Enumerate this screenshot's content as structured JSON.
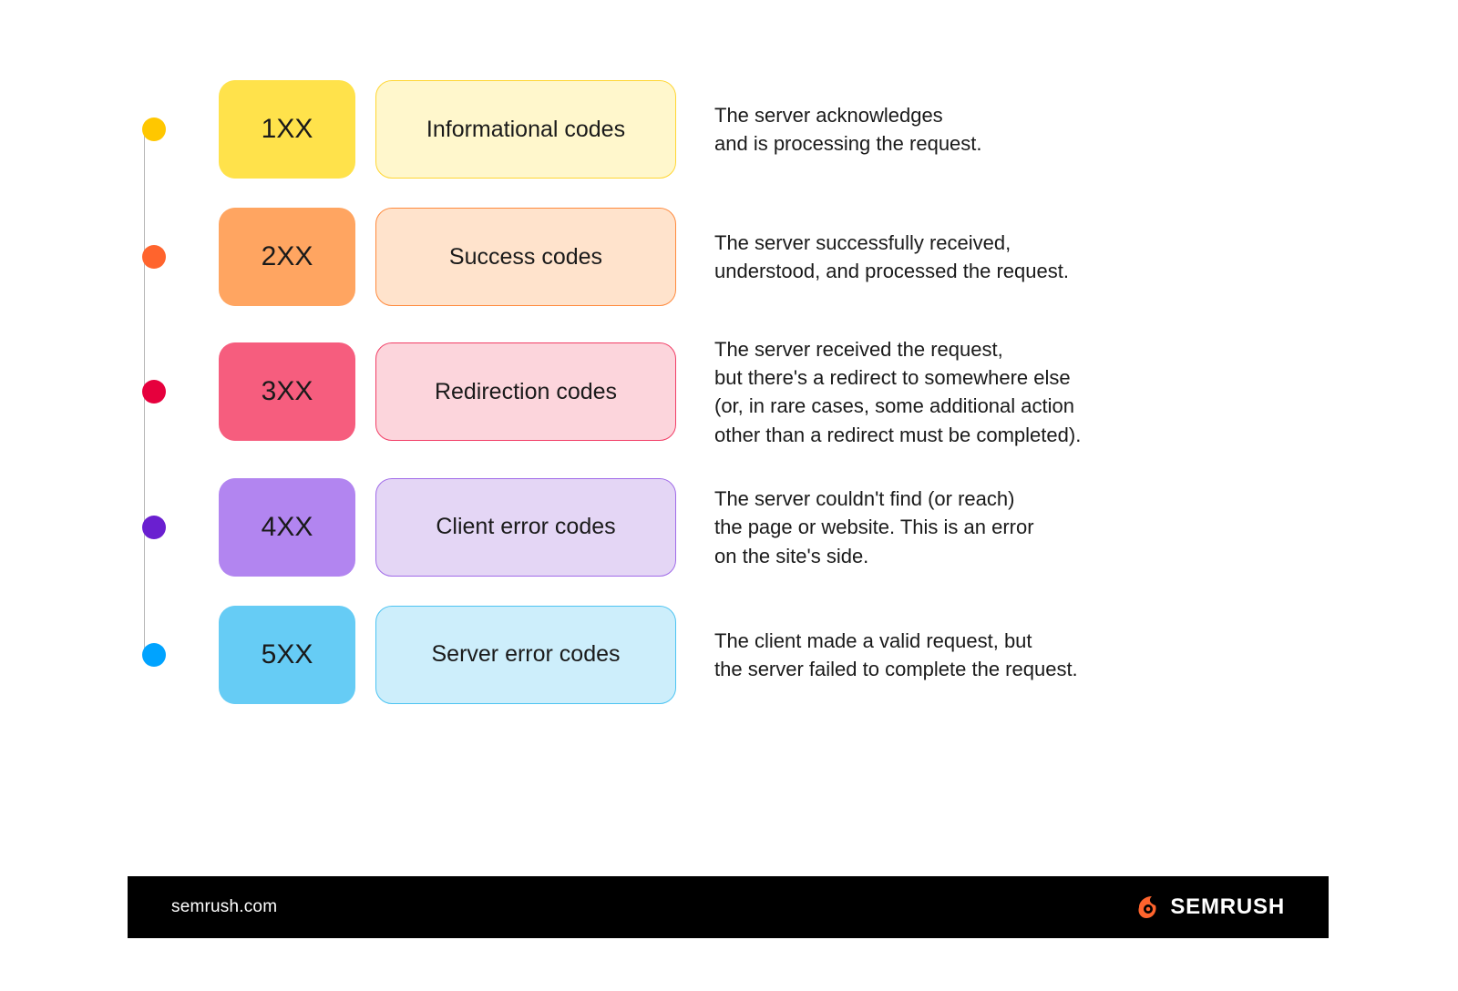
{
  "rows": [
    {
      "code": "1XX",
      "label": "Informational codes",
      "description": "The server acknowledges\nand is processing the request."
    },
    {
      "code": "2XX",
      "label": "Success codes",
      "description": "The server successfully received,\nunderstood, and processed the request."
    },
    {
      "code": "3XX",
      "label": "Redirection codes",
      "description": "The server received the request,\nbut there's a redirect to somewhere else\n(or, in rare cases, some additional action\nother than a redirect must be completed)."
    },
    {
      "code": "4XX",
      "label": "Client error codes",
      "description": "The server couldn't find (or reach)\nthe page or website. This is an error\non the site's side."
    },
    {
      "code": "5XX",
      "label": "Server error codes",
      "description": "The client made a valid request, but\nthe server failed to complete the request."
    }
  ],
  "footer": {
    "url": "semrush.com",
    "brand": "SEMRUSH"
  },
  "colors": {
    "row1": {
      "dot": "#ffc700",
      "code_bg": "#ffe24b",
      "label_bg": "#fff7cc",
      "label_border": "#ffd633"
    },
    "row2": {
      "dot": "#ff642d",
      "code_bg": "#ffa561",
      "label_bg": "#ffe3cc",
      "label_border": "#ff8a3d"
    },
    "row3": {
      "dot": "#e6003d",
      "code_bg": "#f65d7e",
      "label_bg": "#fcd5dc",
      "label_border": "#f13e66"
    },
    "row4": {
      "dot": "#6a1fd0",
      "code_bg": "#b285f0",
      "label_bg": "#e4d6f5",
      "label_border": "#a06be8"
    },
    "row5": {
      "dot": "#00a3ff",
      "code_bg": "#66ccf5",
      "label_bg": "#cdeefb",
      "label_border": "#4dc4f2"
    }
  }
}
